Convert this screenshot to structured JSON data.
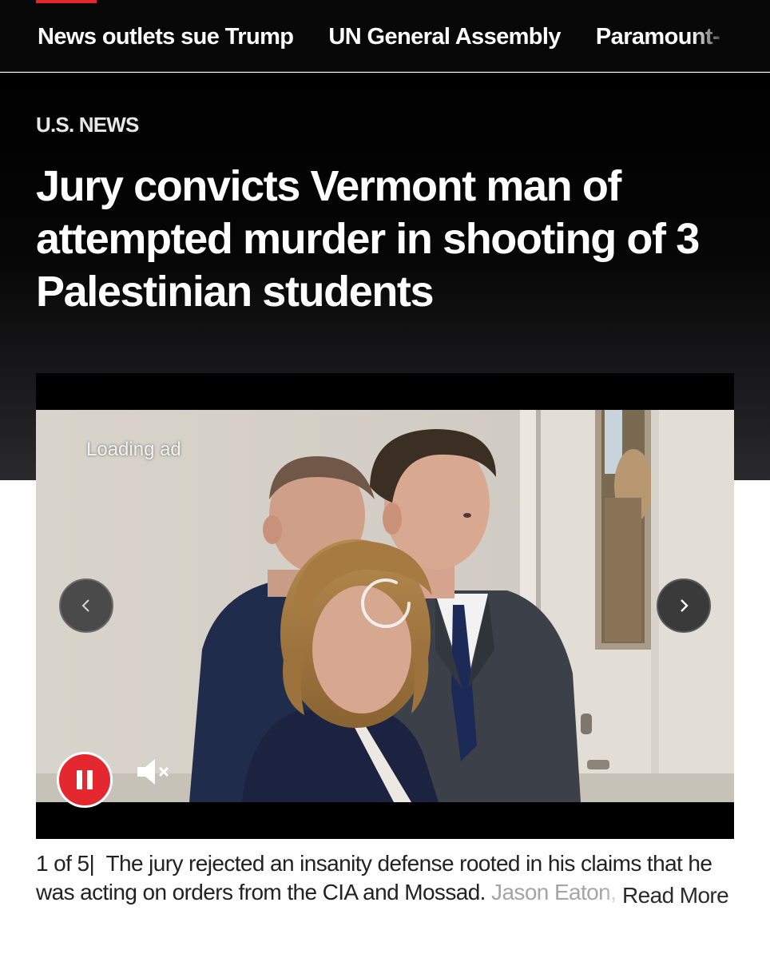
{
  "nav": {
    "links": [
      "News outlets sue Trump",
      "UN General Assembly",
      "Paramount-"
    ]
  },
  "article": {
    "section": "U.S. NEWS",
    "headline": "Jury convicts Vermont man of attempted murder in shooting of 3 Palestinian students"
  },
  "media": {
    "loading_text": "Loading ad",
    "prev_icon": "chevron-left-icon",
    "next_icon": "chevron-right-icon",
    "pause_icon": "pause-icon",
    "mute_icon": "speaker-muted-icon"
  },
  "caption": {
    "counter": "1 of 5",
    "separator": "|",
    "text": "The jury rejected an insanity defense rooted in his claims that he was acting on orders from the CIA and Mossad.",
    "faded_text": "Jason Eaton, h",
    "read_more": "Read More"
  },
  "colors": {
    "accent_red": "#e4262e",
    "nav_background": "#080808",
    "hero_background": "#000000",
    "text_white": "#ffffff",
    "caption_text": "#222222"
  }
}
